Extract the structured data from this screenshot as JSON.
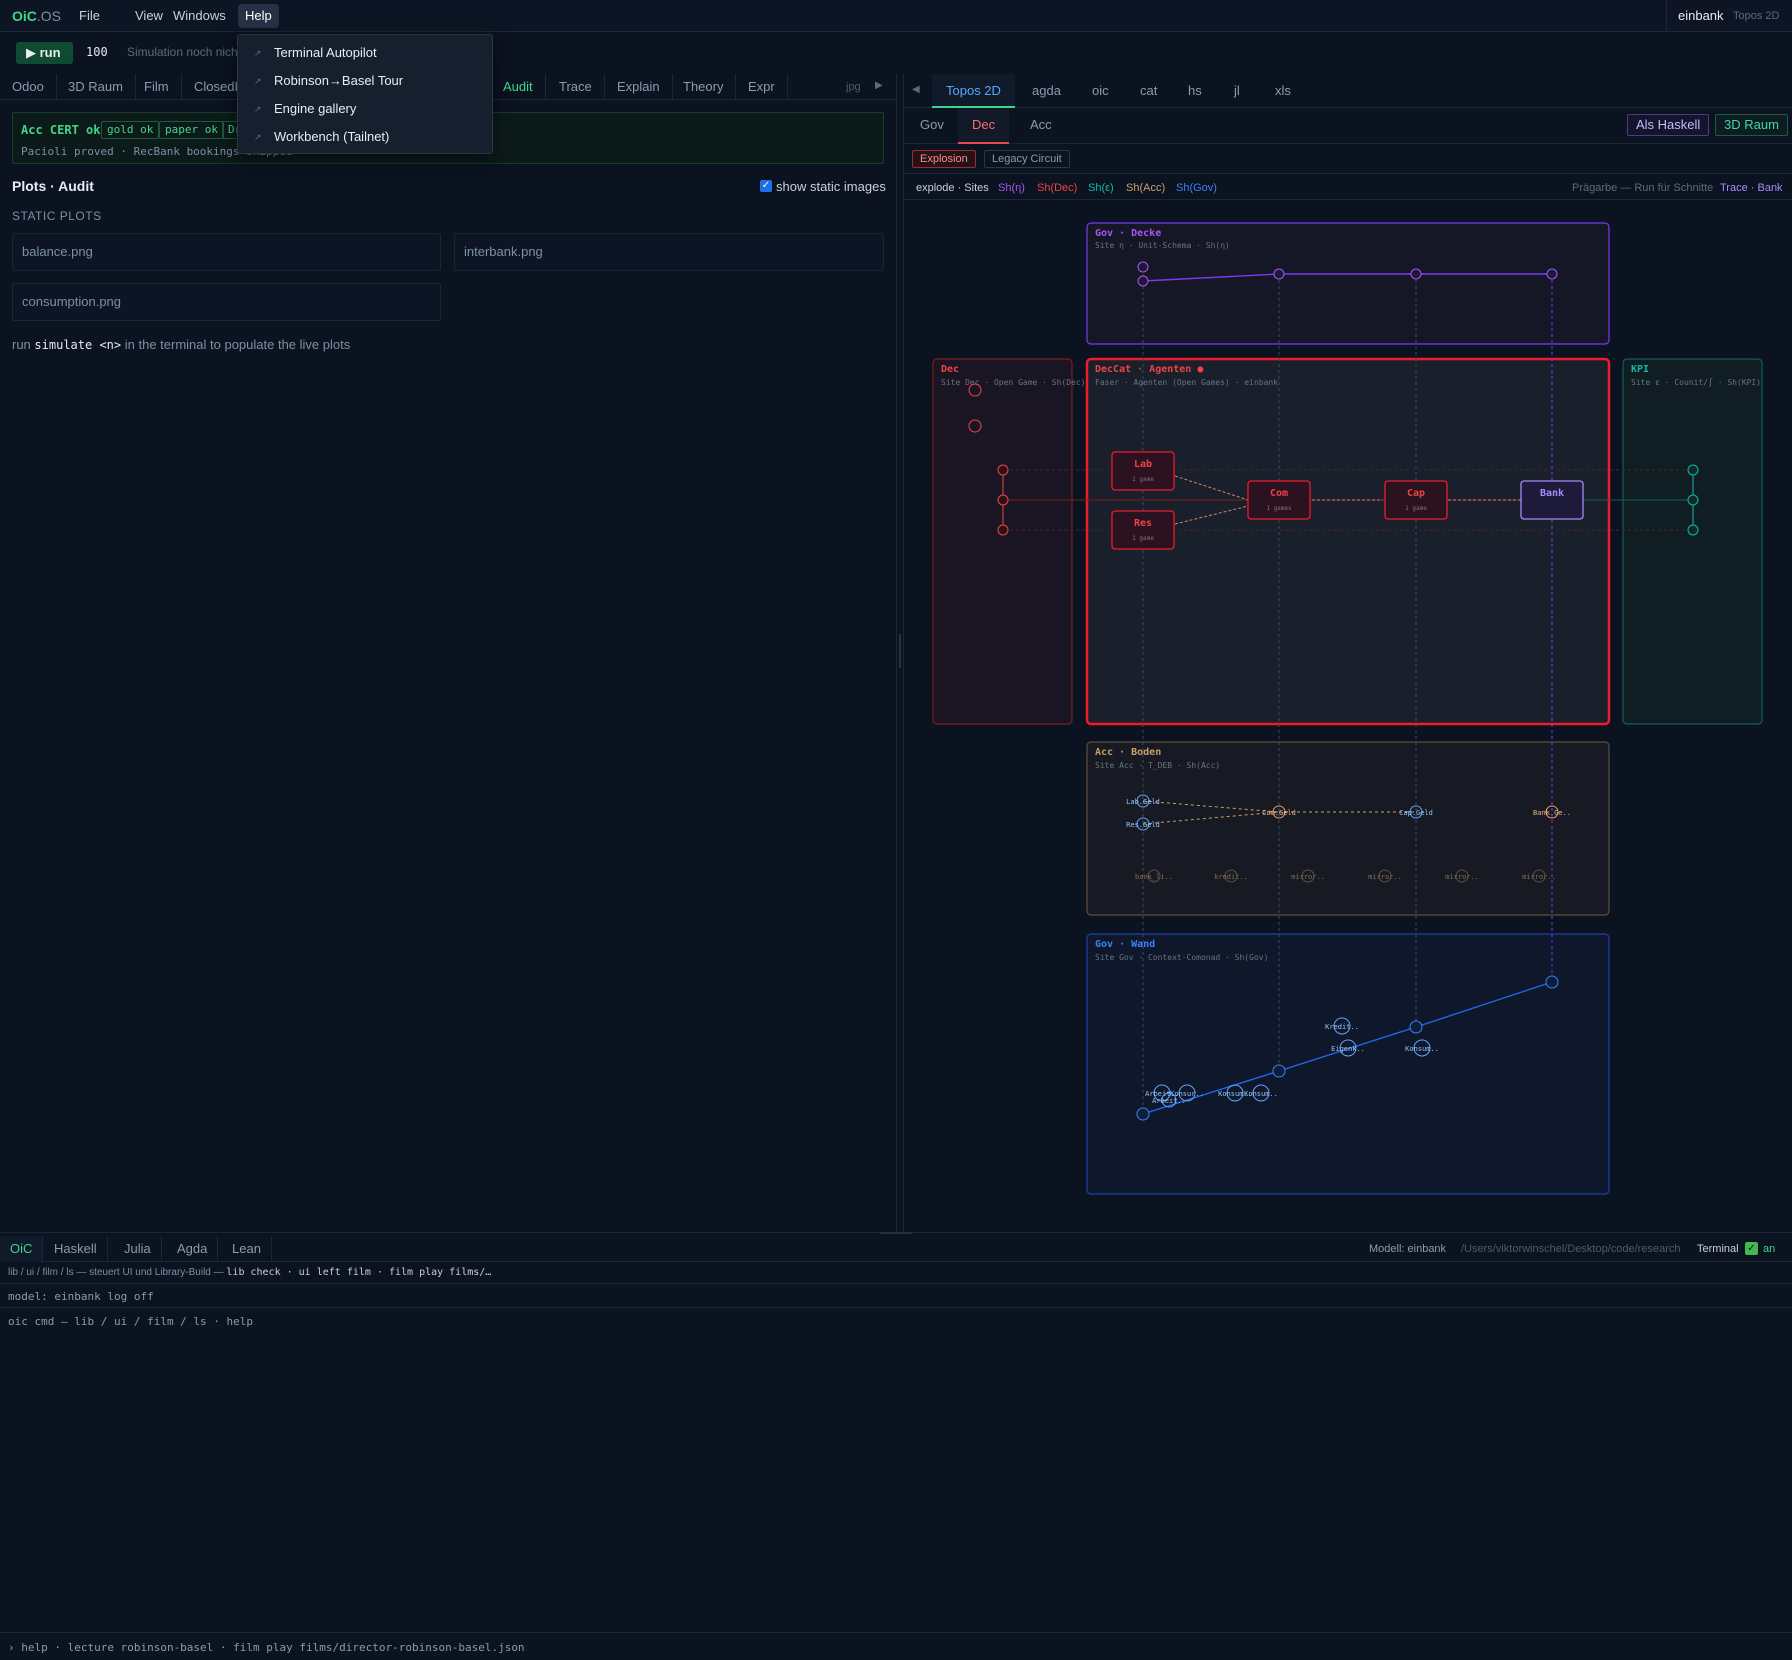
{
  "app": {
    "brand_main": "OiC",
    "brand_dim": ".OS"
  },
  "menu": {
    "file": "File",
    "view": "View",
    "windows": "Windows",
    "help": "Help"
  },
  "help_menu": [
    "Terminal Autopilot",
    "Robinson→Basel Tour",
    "Engine gallery",
    "Workbench (Tailnet)"
  ],
  "top_right": {
    "model": "einbank",
    "view": "Topos 2D"
  },
  "toolbar": {
    "run_label": "▶ run",
    "steps": "100",
    "status": "Simulation noch nicht gestartet"
  },
  "left_tabs": [
    "Odoo",
    "3D Raum",
    "Film",
    "ClosedLoop",
    "",
    "",
    "Audit",
    "Trace",
    "Explain",
    "Theory",
    "Expr",
    "jpg"
  ],
  "cert": {
    "title": "Acc CERT ok",
    "badges": [
      "gold ok",
      "paper ok",
      "Dr"
    ],
    "sub": "Pacioli proved · RecBank bookings skipped"
  },
  "plots": {
    "title": "Plots · Audit",
    "static_label": "show static images",
    "static_heading": "STATIC PLOTS",
    "files": [
      "balance.png",
      "interbank.png",
      "consumption.png"
    ],
    "hint_pre": "run",
    "hint_cmd": "simulate <n>",
    "hint_post": "in the terminal to populate the live plots"
  },
  "right_tabs": [
    "Topos 2D",
    "agda",
    "oic",
    "cat",
    "hs",
    "jl",
    "xls"
  ],
  "site_tabs": [
    "Gov",
    "Dec",
    "Acc"
  ],
  "right_buttons": {
    "haskell": "Als Haskell",
    "raum": "3D Raum"
  },
  "modes": {
    "explosion": "Explosion",
    "legacy": "Legacy Circuit"
  },
  "legend": {
    "label": "explode · Sites",
    "items": [
      {
        "text": "Sh(η)",
        "color": "#a855f7"
      },
      {
        "text": "Sh(Dec)",
        "color": "#ef4444"
      },
      {
        "text": "Sh(ε)",
        "color": "#14b8a6"
      },
      {
        "text": "Sh(Acc)",
        "color": "#c8a06a"
      },
      {
        "text": "Sh(Gov)",
        "color": "#3b82f6"
      }
    ],
    "hint": "Prägarbe — Run für Schnitte",
    "trace_bank": "Trace · Bank"
  },
  "diagram": {
    "gov_decke": {
      "title": "Gov · Decke",
      "sub": "Site η · Unit-Schema · Sh(η)"
    },
    "dec_side": {
      "title": "Dec",
      "sub": "Site Dec · Open Game · Sh(Dec)"
    },
    "deccat": {
      "title": "DecCat · Agenten ●",
      "sub": "Faser · Agenten (Open Games) · einbank"
    },
    "kpi": {
      "title": "KPI",
      "sub": "Site ε · Counit/∫ · Sh(KPI)"
    },
    "acc_boden": {
      "title": "Acc · Boden",
      "sub": "Site Acc · T_DEB · Sh(Acc)"
    },
    "gov_wand": {
      "title": "Gov · Wand",
      "sub": "Site Gov · Context-Comonad · Sh(Gov)"
    },
    "agents": [
      {
        "label": "Lab",
        "sub": "1 game"
      },
      {
        "label": "Res",
        "sub": "1 game"
      },
      {
        "label": "Com",
        "sub": "1 games"
      },
      {
        "label": "Cap",
        "sub": "1 game"
      },
      {
        "label": "Bank",
        "sub": ""
      }
    ],
    "acc_nodes": [
      "Lab.Geld",
      "Res.Geld",
      "Com.Geld",
      "Cap.Geld",
      "Bank.Ge.."
    ],
    "acc_bottom": [
      "bank_li..",
      "kredit..",
      "mirror..",
      "mirror..",
      "mirror..",
      "mirror.."
    ],
    "gov_nodes": [
      "Kredit..",
      "Eigenk..",
      "Konsum..",
      "Arbeit..",
      "Konsur..",
      "Konsum..",
      "Konsum..",
      "Arbeit.."
    ],
    "colors": {
      "gov": "#a855f7",
      "dec": "#ef4444",
      "kpi": "#14b8a6",
      "acc": "#c8a06a",
      "wand": "#3b82f6",
      "bank": "#a78bfa",
      "accnode": "#60a5fa"
    }
  },
  "terminal": {
    "tabs": [
      "OiC",
      "Haskell",
      "Julia",
      "Agda",
      "Lean"
    ],
    "model": "Modell: einbank",
    "path": "/Users/viktorwinschel/Desktop/code/research",
    "label": "Terminal",
    "on": "an",
    "hint_pre": "lib / ui / film / ls — steuert UI und Library-Build —",
    "hint_cmds": "lib check · ui left film · film play films/…",
    "status": "model: einbank  log off",
    "output": "oic cmd — lib / ui / film / ls · help",
    "bottom": "› help · lecture robinson-basel · film play films/director-robinson-basel.json"
  }
}
